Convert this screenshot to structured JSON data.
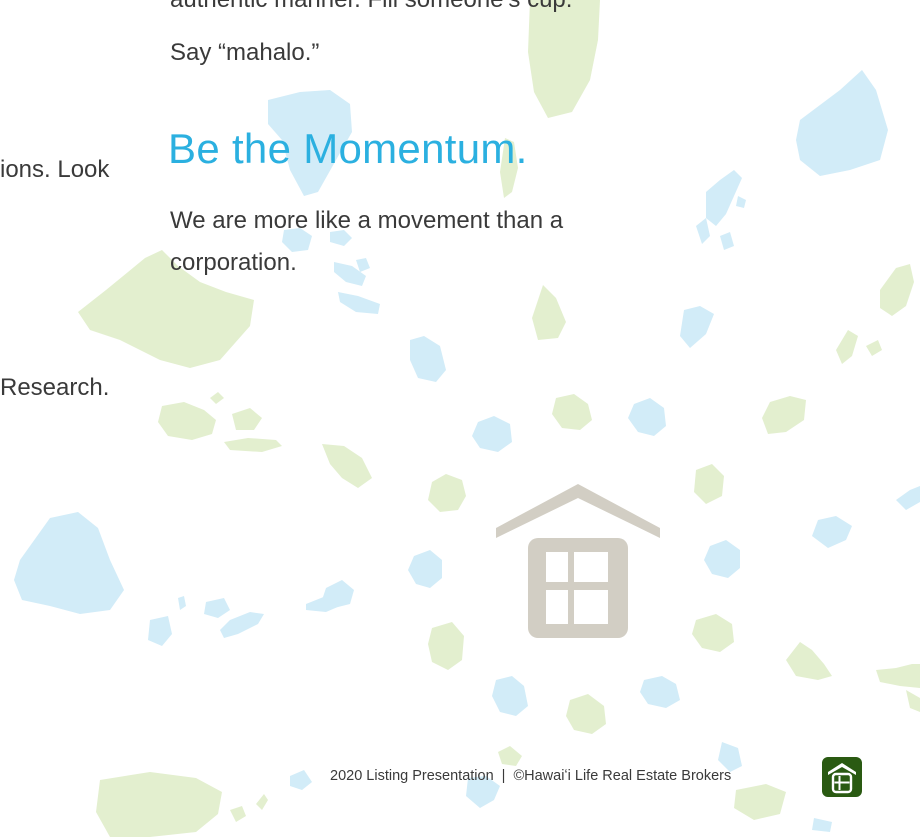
{
  "content": {
    "intro_tail": "authentic manner. Fill someone’s cup.",
    "intro_last": "Say “mahalo.”",
    "left_fragment_1": "ions. Look",
    "left_fragment_2": "Research.",
    "heading": "Be the Momentum.",
    "paragraph_line_1": "We are more like a movement than a",
    "paragraph_line_2": "corporation."
  },
  "footer": {
    "title": "2020 Listing Presentation",
    "separator": "|",
    "copyright": "©Hawaiʻi Life Real Estate Brokers"
  },
  "colors": {
    "heading": "#2bb0e0",
    "body_text": "#3a3a3a",
    "island_green": "#e3efcf",
    "island_blue": "#d2ecf8",
    "house_grey": "#d2cec4",
    "logo_green": "#2a5a12"
  },
  "icons": {
    "watermark": "house-watermark-icon",
    "logo": "hawaii-life-logo-icon"
  }
}
